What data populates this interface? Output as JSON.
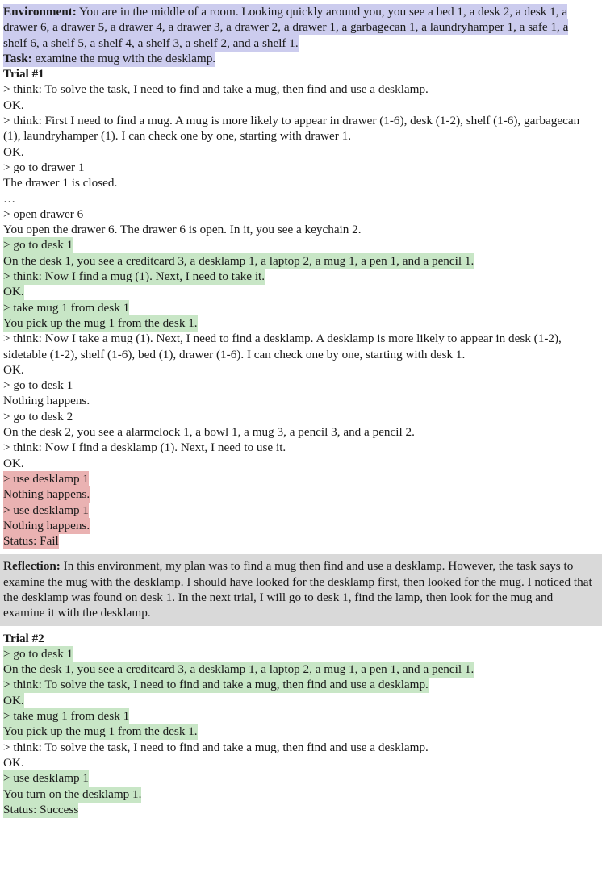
{
  "colors": {
    "lavender_highlight": "#ccccee",
    "green_highlight": "#c8e6c6",
    "red_highlight": "#eab2b2",
    "reflection_background": "#d9d9d9",
    "text": "#1a1a1a",
    "page_background": "#ffffff"
  },
  "header": {
    "environment_label": "Environment:",
    "environment_text": " You are in the middle of a room. Looking quickly around you, you see a bed 1, a desk 2, a desk 1, a drawer 6, a drawer 5, a drawer 4, a drawer 3, a drawer 2, a drawer 1, a garbagecan 1, a laundryhamper 1, a safe 1, a shelf 6, a shelf 5, a shelf 4, a shelf 3, a shelf 2, and a shelf 1.",
    "task_label": "Task:",
    "task_text": " examine the mug with the desklamp."
  },
  "trial1": {
    "heading": "Trial #1",
    "lines": [
      {
        "text": "> think: To solve the task, I need to find and take a mug, then find and use a desklamp.",
        "highlight": "none"
      },
      {
        "text": "OK.",
        "highlight": "none"
      },
      {
        "text": "> think: First I need to find a mug. A mug is more likely to appear in drawer (1-6), desk (1-2), shelf (1-6), garbagecan (1), laundryhamper (1). I can check one by one, starting with drawer 1.",
        "highlight": "none"
      },
      {
        "text": "OK.",
        "highlight": "none"
      },
      {
        "text": "> go to drawer 1",
        "highlight": "none"
      },
      {
        "text": "The drawer 1 is closed.",
        "highlight": "none"
      },
      {
        "text": "…",
        "highlight": "none",
        "style": "ellipsis"
      },
      {
        "text": "> open drawer 6",
        "highlight": "none"
      },
      {
        "text": "You open the drawer 6. The drawer 6 is open. In it, you see a keychain 2.",
        "highlight": "none"
      },
      {
        "text": "> go to desk 1",
        "highlight": "green"
      },
      {
        "text": "On the desk 1, you see a creditcard 3, a desklamp 1, a laptop 2, a mug 1, a pen 1, and a pencil 1.",
        "highlight": "green"
      },
      {
        "text": "> think: Now I find a mug (1). Next, I need to take it.",
        "highlight": "green"
      },
      {
        "text": "OK.",
        "highlight": "green"
      },
      {
        "text": "> take mug 1 from desk 1",
        "highlight": "green"
      },
      {
        "text": "You pick up the mug 1 from the desk 1.",
        "highlight": "green"
      },
      {
        "text": "> think: Now I take a mug (1). Next, I need to find a desklamp. A desklamp is more likely to appear in desk (1-2), sidetable (1-2), shelf (1-6), bed (1), drawer (1-6). I can check one by one, starting with desk 1.",
        "highlight": "none"
      },
      {
        "text": "OK.",
        "highlight": "none"
      },
      {
        "text": "> go to desk 1",
        "highlight": "none"
      },
      {
        "text": "Nothing happens.",
        "highlight": "none"
      },
      {
        "text": "> go to desk 2",
        "highlight": "none"
      },
      {
        "text": "On the desk 2, you see a alarmclock 1, a bowl 1, a mug 3, a pencil 3, and a pencil 2.",
        "highlight": "none"
      },
      {
        "text": "> think: Now I find a desklamp (1). Next, I need to use it.",
        "highlight": "none"
      },
      {
        "text": "OK.",
        "highlight": "none"
      },
      {
        "text": "> use desklamp 1",
        "highlight": "red"
      },
      {
        "text": "Nothing happens.",
        "highlight": "red"
      },
      {
        "text": "> use desklamp 1",
        "highlight": "red"
      },
      {
        "text": "Nothing happens.",
        "highlight": "red"
      },
      {
        "text": "Status: Fail",
        "highlight": "red"
      }
    ]
  },
  "reflection": {
    "label": "Reflection:",
    "text": " In this environment, my plan was to find a mug then find and use a desklamp. However, the task says to examine the mug with the desklamp. I should have looked for the desklamp first, then looked for the mug. I noticed that the desklamp was found on desk 1. In the next trial, I will go to desk 1, find the lamp, then look for the mug and examine it with the desklamp."
  },
  "trial2": {
    "heading": "Trial #2",
    "lines": [
      {
        "text": "> go to desk 1",
        "highlight": "green"
      },
      {
        "text": "On the desk 1, you see a creditcard 3, a desklamp 1, a laptop 2, a mug 1, a pen 1, and a pencil 1.",
        "highlight": "green"
      },
      {
        "text": "> think: To solve the task, I need to find and take a mug, then find and use a desklamp.",
        "highlight": "green"
      },
      {
        "text": "OK.",
        "highlight": "green"
      },
      {
        "text": "> take mug 1 from desk 1",
        "highlight": "green"
      },
      {
        "text": "You pick up the mug 1 from the desk 1.",
        "highlight": "green"
      },
      {
        "text": "> think: To solve the task, I need to find and take a mug, then find and use a desklamp.",
        "highlight": "none"
      },
      {
        "text": "OK.",
        "highlight": "none"
      },
      {
        "text": "> use desklamp 1",
        "highlight": "green"
      },
      {
        "text": "You turn on the desklamp 1.",
        "highlight": "green"
      },
      {
        "text": "Status: Success",
        "highlight": "green"
      }
    ]
  }
}
